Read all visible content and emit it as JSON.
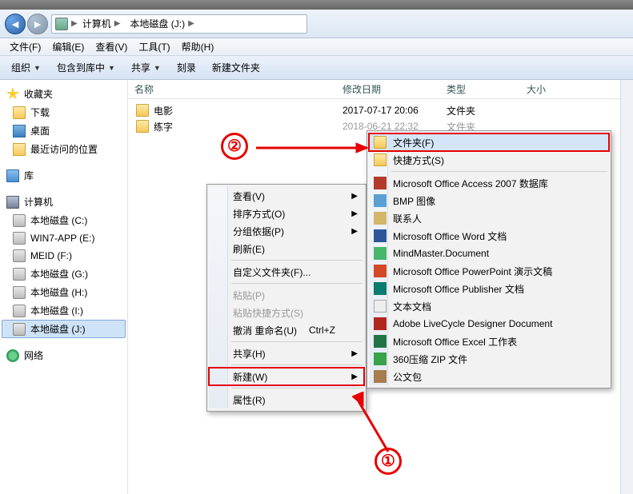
{
  "breadcrumb": {
    "root": "计算机",
    "path1": "本地磁盘 (J:)"
  },
  "menubar": {
    "file": "文件(F)",
    "edit": "编辑(E)",
    "view": "查看(V)",
    "tools": "工具(T)",
    "help": "帮助(H)"
  },
  "toolbar": {
    "organize": "组织",
    "include": "包含到库中",
    "share": "共享",
    "burn": "刻录",
    "newfolder": "新建文件夹"
  },
  "columns": {
    "name": "名称",
    "date": "修改日期",
    "type": "类型",
    "size": "大小"
  },
  "rows": [
    {
      "name": "电影",
      "date": "2017-07-17 20:06",
      "type": "文件夹"
    },
    {
      "name": "练字",
      "date": "2018-06-21 22:32",
      "type": "文件夹"
    }
  ],
  "sidebar": {
    "fav_header": "收藏夹",
    "fav": [
      "下载",
      "桌面",
      "最近访问的位置"
    ],
    "lib_header": "库",
    "pc_header": "计算机",
    "drives": [
      "本地磁盘 (C:)",
      "WIN7-APP (E:)",
      "MEID (F:)",
      "本地磁盘 (G:)",
      "本地磁盘 (H:)",
      "本地磁盘 (I:)",
      "本地磁盘 (J:)"
    ],
    "net_header": "网络"
  },
  "ctx1": {
    "view": "查看(V)",
    "sort": "排序方式(O)",
    "group": "分组依据(P)",
    "refresh": "刷新(E)",
    "custom": "自定义文件夹(F)...",
    "paste": "粘贴(P)",
    "pastelink": "粘贴快捷方式(S)",
    "undo": "撤消 重命名(U)",
    "undo_hk": "Ctrl+Z",
    "share": "共享(H)",
    "new": "新建(W)",
    "props": "属性(R)"
  },
  "ctx2": {
    "folder": "文件夹(F)",
    "shortcut": "快捷方式(S)",
    "access": "Microsoft Office Access 2007 数据库",
    "bmp": "BMP 图像",
    "contact": "联系人",
    "word": "Microsoft Office Word 文档",
    "mind": "MindMaster.Document",
    "ppt": "Microsoft Office PowerPoint 演示文稿",
    "pub": "Microsoft Office Publisher 文档",
    "txt": "文本文档",
    "adobe": "Adobe LiveCycle Designer Document",
    "excel": "Microsoft Office Excel 工作表",
    "zip": "360压缩 ZIP 文件",
    "briefcase": "公文包"
  },
  "anno": {
    "one": "①",
    "two": "②"
  }
}
